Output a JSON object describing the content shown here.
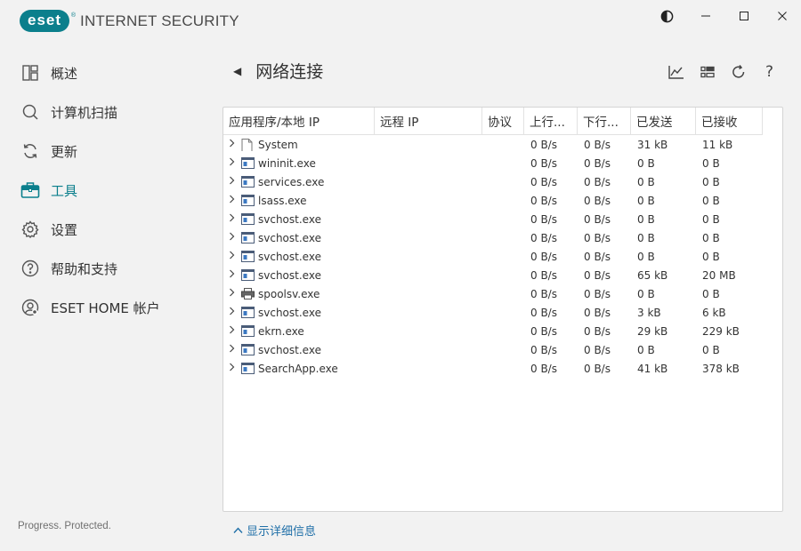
{
  "app": {
    "logo_text": "eset",
    "logo_reg": "®",
    "product_name": "INTERNET SECURITY",
    "tagline": "Progress. Protected."
  },
  "window_controls": {
    "theme_icon": "contrast-icon",
    "minimize": "—",
    "maximize": "☐",
    "close": "✕"
  },
  "sidebar": {
    "items": [
      {
        "label": "概述",
        "icon": "dashboard-icon"
      },
      {
        "label": "计算机扫描",
        "icon": "scan-icon"
      },
      {
        "label": "更新",
        "icon": "refresh-icon"
      },
      {
        "label": "工具",
        "icon": "toolbox-icon",
        "active": true
      },
      {
        "label": "设置",
        "icon": "gear-icon"
      },
      {
        "label": "帮助和支持",
        "icon": "help-icon"
      },
      {
        "label": "ESET HOME 帐户",
        "icon": "account-icon"
      }
    ]
  },
  "header": {
    "back": "◀",
    "title": "网络连接",
    "tools": [
      "chart-icon",
      "view-toggle-icon",
      "refresh-icon",
      "help-icon"
    ],
    "help_glyph": "?"
  },
  "table": {
    "columns": [
      "应用程序/本地 IP",
      "远程 IP",
      "协议",
      "上行...",
      "下行...",
      "已发送",
      "已接收"
    ],
    "rows": [
      {
        "name": "System",
        "icon": "file-icon",
        "remote": "",
        "proto": "",
        "up": "0 B/s",
        "down": "0 B/s",
        "sent": "31 kB",
        "recv": "11 kB"
      },
      {
        "name": "wininit.exe",
        "icon": "app-window-icon",
        "remote": "",
        "proto": "",
        "up": "0 B/s",
        "down": "0 B/s",
        "sent": "0 B",
        "recv": "0 B"
      },
      {
        "name": "services.exe",
        "icon": "app-window-icon",
        "remote": "",
        "proto": "",
        "up": "0 B/s",
        "down": "0 B/s",
        "sent": "0 B",
        "recv": "0 B"
      },
      {
        "name": "lsass.exe",
        "icon": "app-window-icon",
        "remote": "",
        "proto": "",
        "up": "0 B/s",
        "down": "0 B/s",
        "sent": "0 B",
        "recv": "0 B"
      },
      {
        "name": "svchost.exe",
        "icon": "app-window-icon",
        "remote": "",
        "proto": "",
        "up": "0 B/s",
        "down": "0 B/s",
        "sent": "0 B",
        "recv": "0 B"
      },
      {
        "name": "svchost.exe",
        "icon": "app-window-icon",
        "remote": "",
        "proto": "",
        "up": "0 B/s",
        "down": "0 B/s",
        "sent": "0 B",
        "recv": "0 B"
      },
      {
        "name": "svchost.exe",
        "icon": "app-window-icon",
        "remote": "",
        "proto": "",
        "up": "0 B/s",
        "down": "0 B/s",
        "sent": "0 B",
        "recv": "0 B"
      },
      {
        "name": "svchost.exe",
        "icon": "app-window-icon",
        "remote": "",
        "proto": "",
        "up": "0 B/s",
        "down": "0 B/s",
        "sent": "65 kB",
        "recv": "20 MB"
      },
      {
        "name": "spoolsv.exe",
        "icon": "printer-icon",
        "remote": "",
        "proto": "",
        "up": "0 B/s",
        "down": "0 B/s",
        "sent": "0 B",
        "recv": "0 B"
      },
      {
        "name": "svchost.exe",
        "icon": "app-window-icon",
        "remote": "",
        "proto": "",
        "up": "0 B/s",
        "down": "0 B/s",
        "sent": "3 kB",
        "recv": "6 kB"
      },
      {
        "name": "ekrn.exe",
        "icon": "app-window-icon",
        "remote": "",
        "proto": "",
        "up": "0 B/s",
        "down": "0 B/s",
        "sent": "29 kB",
        "recv": "229 kB"
      },
      {
        "name": "svchost.exe",
        "icon": "app-window-icon",
        "remote": "",
        "proto": "",
        "up": "0 B/s",
        "down": "0 B/s",
        "sent": "0 B",
        "recv": "0 B"
      },
      {
        "name": "SearchApp.exe",
        "icon": "app-window-icon",
        "remote": "",
        "proto": "",
        "up": "0 B/s",
        "down": "0 B/s",
        "sent": "41 kB",
        "recv": "378 kB"
      }
    ]
  },
  "footer": {
    "show_details": "显示详细信息"
  },
  "colors": {
    "accent": "#0b7f8c",
    "link": "#1f6fa8",
    "background": "#f2f2f2"
  }
}
